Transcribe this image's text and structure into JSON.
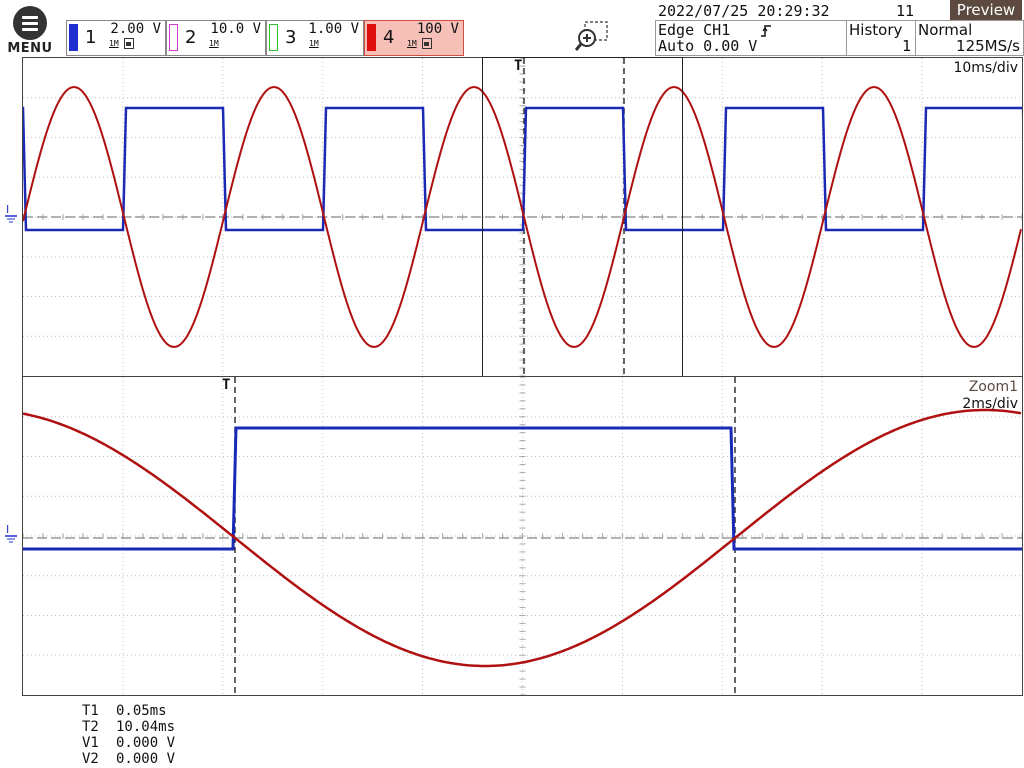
{
  "menu": {
    "label": "MENU",
    "icon": "hamburger-menu-icon"
  },
  "channels": [
    {
      "id": "ch1",
      "number": "1",
      "scale": "2.00 V",
      "color": "#2030d0",
      "active": false,
      "coupling": "1M"
    },
    {
      "id": "ch2",
      "number": "2",
      "scale": "10.0 V",
      "color": "#d040d0",
      "active": false,
      "coupling": "1M"
    },
    {
      "id": "ch3",
      "number": "3",
      "scale": "1.00 V",
      "color": "#30c030",
      "active": false,
      "coupling": "1M"
    },
    {
      "id": "ch4",
      "number": "4",
      "scale": "100 V",
      "color": "#e01010",
      "active": true,
      "coupling": "1M"
    }
  ],
  "zoom_icon": "zoom-in-icon",
  "header": {
    "datetime": "2022/07/25 20:29:32",
    "acq_count": "11",
    "preview_label": "Preview",
    "trigger_type": "Edge CH1",
    "trigger_mode": "Auto 0.00 V",
    "history_label": "History",
    "history_value": "1",
    "acq_mode": "Normal",
    "sample_rate": "125MS/s"
  },
  "main_plot": {
    "timebase": "10ms/div",
    "trigger_marker": "T"
  },
  "zoom_plot": {
    "title": "Zoom1",
    "timebase": "2ms/div",
    "trigger_marker": "T"
  },
  "cursors": {
    "T1_label": "T1",
    "T1_value": "0.05ms",
    "T2_label": "T2",
    "T2_value": "10.04ms",
    "V1_label": "V1",
    "V1_value": "0.000 V",
    "V2_label": "V2",
    "V2_value": "0.000 V"
  },
  "colors": {
    "ch1_trace": "#1a2ab5",
    "ch4_trace": "#b01010",
    "grid": "#c8c8c8",
    "header_bg": "#5c4a40"
  }
}
